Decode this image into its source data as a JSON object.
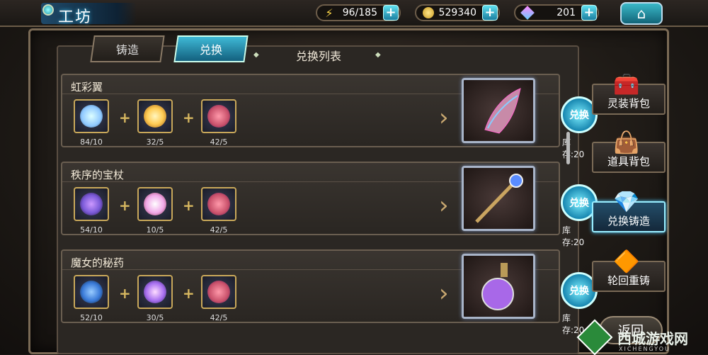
{
  "header": {
    "title": "工坊",
    "resources": [
      {
        "icon": "lightning-icon",
        "value": "96/185"
      },
      {
        "icon": "gold-coin-icon",
        "value": "529340"
      },
      {
        "icon": "crystal-icon",
        "value": "201"
      }
    ],
    "home_icon": "home-icon"
  },
  "tabs": {
    "forge": "铸造",
    "exchange": "兑换",
    "list_title": "兑换列表"
  },
  "recipes": [
    {
      "name": "虹彩翼",
      "materials": [
        {
          "count": "84/10",
          "color": "#8fc8ff"
        },
        {
          "count": "32/5",
          "color": "#ffcc55"
        },
        {
          "count": "42/5",
          "color": "#c8506a"
        }
      ],
      "button": "兑换",
      "stock": "库存:20"
    },
    {
      "name": "秩序的宝杖",
      "materials": [
        {
          "count": "54/10",
          "color": "#7a5ad8"
        },
        {
          "count": "10/5",
          "color": "#f0a8e8"
        },
        {
          "count": "42/5",
          "color": "#c8506a"
        }
      ],
      "button": "兑换",
      "stock": "库存:20"
    },
    {
      "name": "魔女的秘药",
      "materials": [
        {
          "count": "52/10",
          "color": "#3a7ad8"
        },
        {
          "count": "30/5",
          "color": "#a870f0"
        },
        {
          "count": "42/5",
          "color": "#c8506a"
        }
      ],
      "button": "兑换",
      "stock": "库存:20"
    }
  ],
  "sidebar": {
    "items": [
      {
        "label": "灵装背包",
        "icon": "chest-icon"
      },
      {
        "label": "道具背包",
        "icon": "bag-icon"
      },
      {
        "label": "兑换铸造",
        "icon": "crystal-icon"
      },
      {
        "label": "轮回重铸",
        "icon": "gem-icon"
      }
    ],
    "back": "返回"
  },
  "watermark": {
    "text": "西城游戏网",
    "sub": "XICHENGYOU"
  }
}
